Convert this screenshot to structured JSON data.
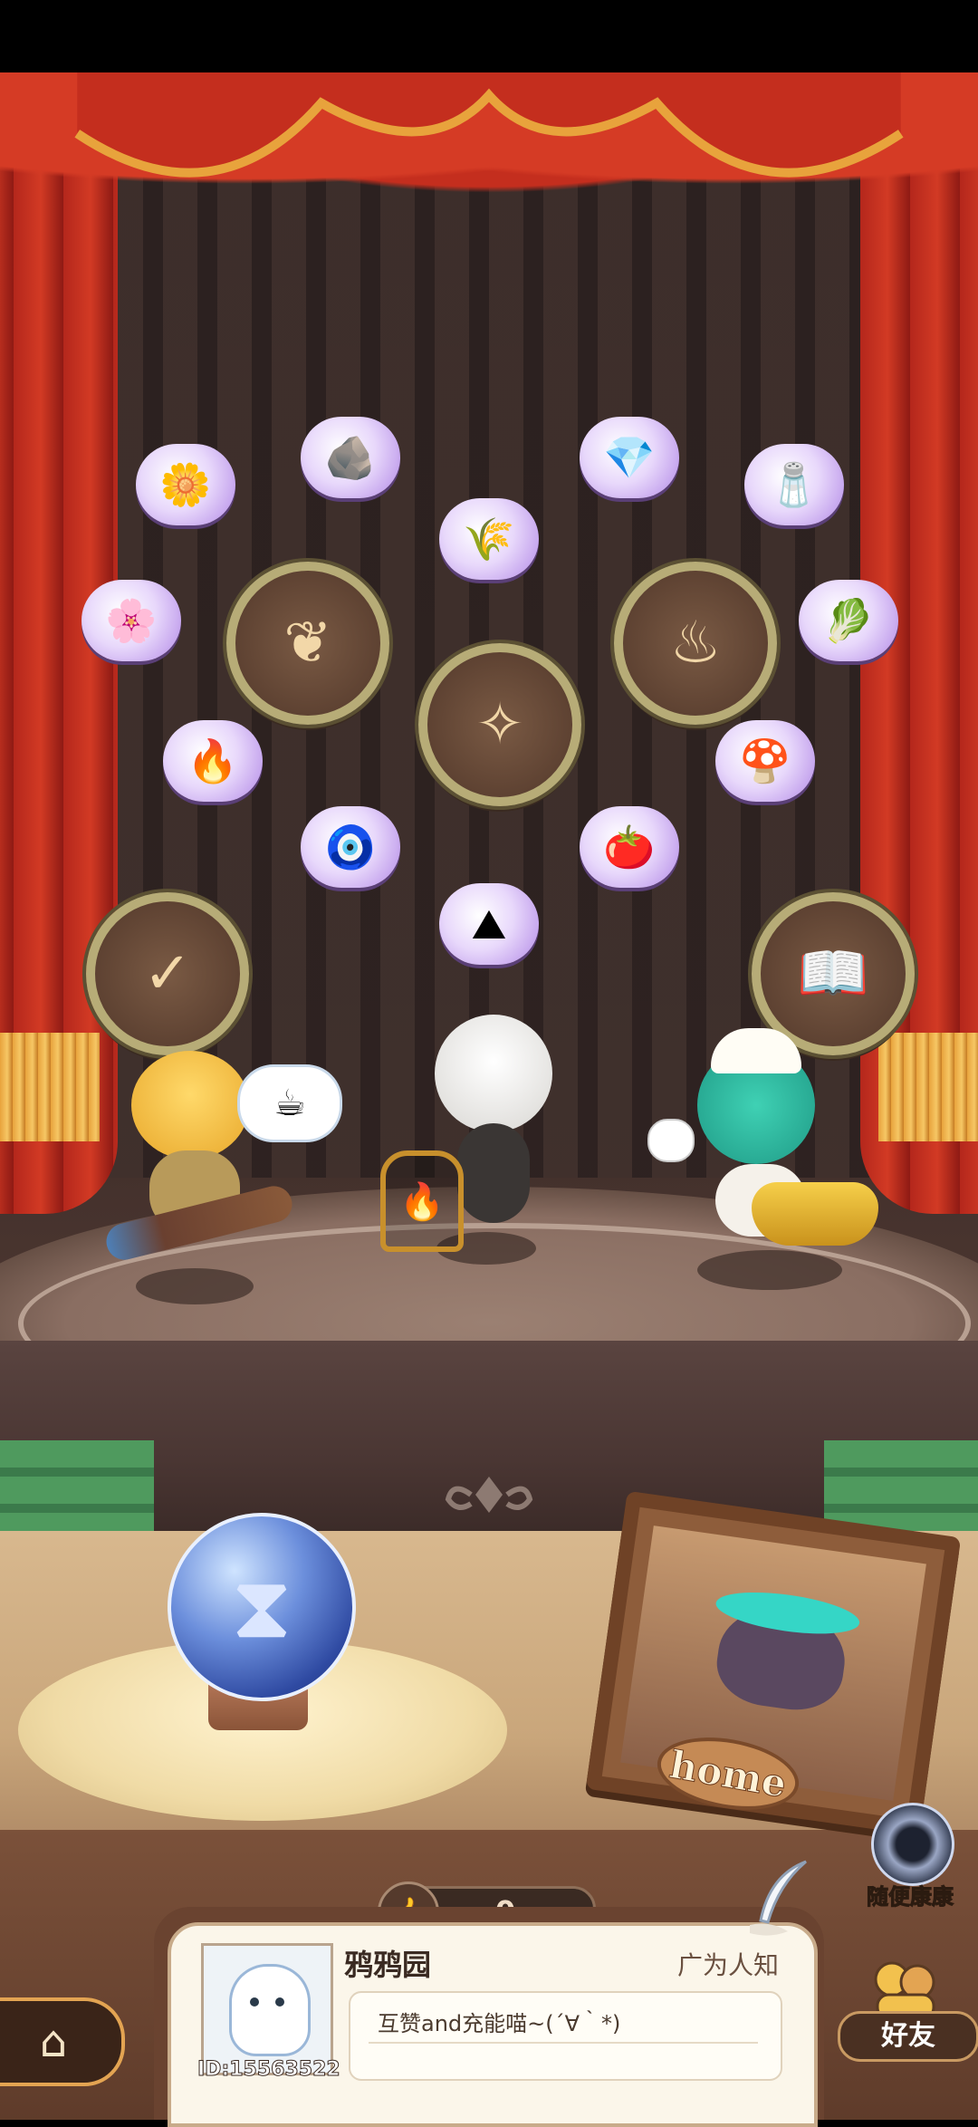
{
  "game": {
    "home_plate_text": "home",
    "likes": {
      "count": "0"
    },
    "profile": {
      "name": "鸦鸦园",
      "title": "广为人知",
      "motto": "互赞and充能喵~(´∀｀*)",
      "id_text": "ID:15563522"
    },
    "random_visit": {
      "label": "随便康康"
    },
    "friends": {
      "label": "好友"
    },
    "icons": {
      "home": "house-icon",
      "likes": "thumbs-up-icon",
      "crystal_ball": "hourglass-icon",
      "random_visit": "portal-icon",
      "friends": "friends-icon",
      "quill": "quill-icon"
    },
    "colors": {
      "curtain": "#c42e1e",
      "stage": "#8a6e62",
      "card": "#fbf6ea",
      "accent_gold": "#e3a452"
    }
  }
}
